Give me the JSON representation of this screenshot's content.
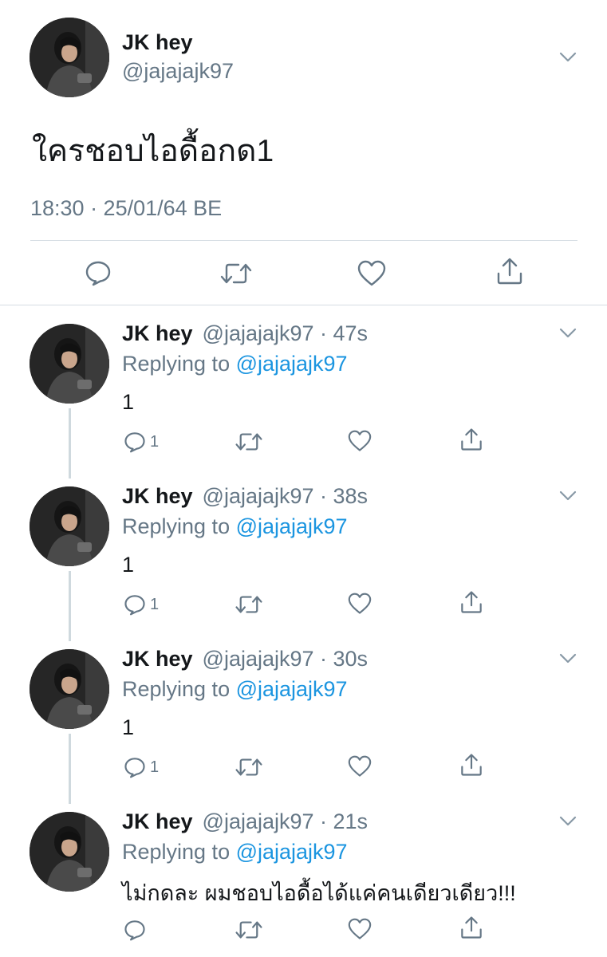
{
  "tweet": {
    "display_name": "JK hey",
    "handle": "@jajajajk97",
    "text": "ใครชอบไอดื้อกด1",
    "timestamp": "18:30 · 25/01/64 BE"
  },
  "replies": [
    {
      "display_name": "JK hey",
      "meta": "@jajajajk97 · 47s",
      "replying_prefix": "Replying to ",
      "replying_to": "@jajajajk97",
      "text": "1",
      "reply_count": "1"
    },
    {
      "display_name": "JK hey",
      "meta": "@jajajajk97 · 38s",
      "replying_prefix": "Replying to ",
      "replying_to": "@jajajajk97",
      "text": "1",
      "reply_count": "1"
    },
    {
      "display_name": "JK hey",
      "meta": "@jajajajk97 · 30s",
      "replying_prefix": "Replying to ",
      "replying_to": "@jajajajk97",
      "text": "1",
      "reply_count": "1"
    },
    {
      "display_name": "JK hey",
      "meta": "@jajajajk97 · 21s",
      "replying_prefix": "Replying to ",
      "replying_to": "@jajajajk97",
      "text": "ไม่กดละ ผมชอบไอดื้อได้แค่คนเดียวเดียว!!!",
      "reply_count": ""
    }
  ],
  "icons": {
    "reply": "reply-icon",
    "retweet": "retweet-icon",
    "like": "heart-icon",
    "share": "share-icon",
    "more": "chevron-down-icon"
  },
  "colors": {
    "text": "#14171a",
    "secondary": "#657786",
    "link": "#1b95e0",
    "divider": "#d5dde3"
  }
}
